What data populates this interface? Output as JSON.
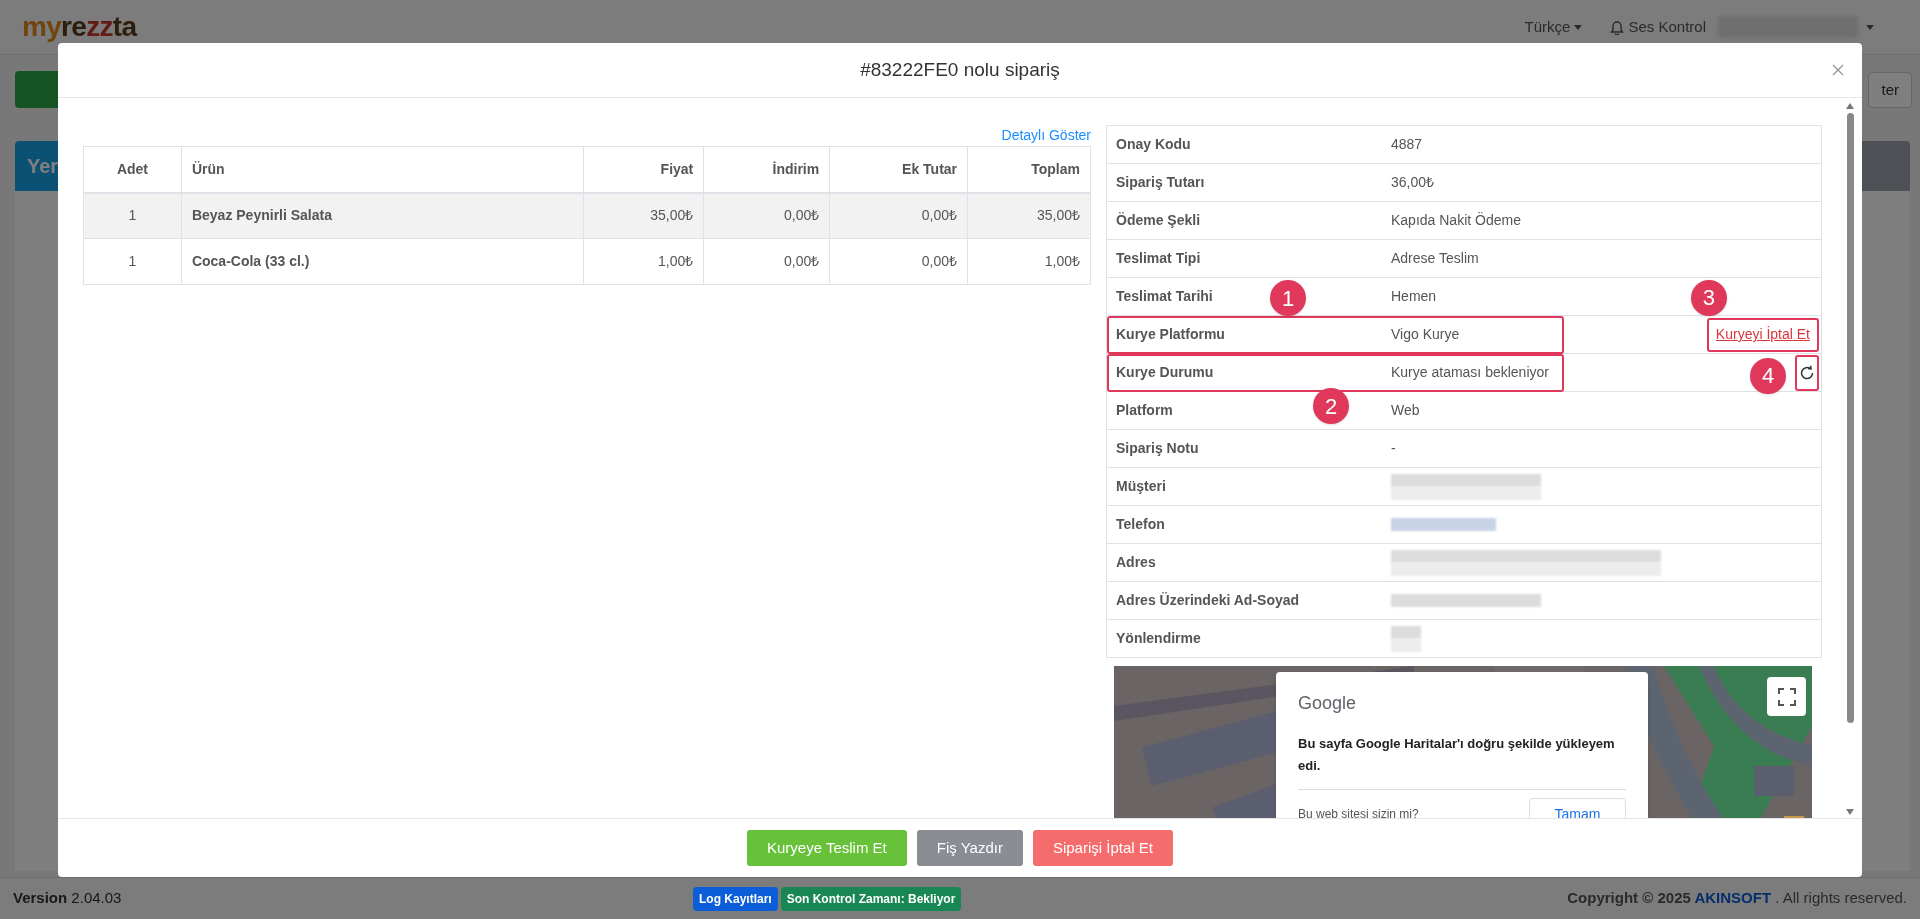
{
  "navbar": {
    "logo": [
      "my",
      "re",
      "zz",
      "ta"
    ],
    "language": "Türkçe",
    "sound": "Ses Kontrol"
  },
  "background": {
    "left_card_title": "Yer",
    "right_button": "ter"
  },
  "modal": {
    "title": "#83222FE0 nolu sipariş",
    "detail_link": "Detaylı Göster",
    "items_table": {
      "columns": [
        "Adet",
        "Ürün",
        "Fiyat",
        "İndirim",
        "Ek Tutar",
        "Toplam"
      ],
      "rows": [
        {
          "cells": [
            "1",
            "Beyaz Peynirli Salata",
            "35,00₺",
            "0,00₺",
            "0,00₺",
            "35,00₺"
          ],
          "hovered": true
        },
        {
          "cells": [
            "1",
            "Coca-Cola (33 cl.)",
            "1,00₺",
            "0,00₺",
            "0,00₺",
            "1,00₺"
          ],
          "hovered": false
        }
      ]
    },
    "info_rows": [
      {
        "label": "Onay Kodu",
        "value": "4887",
        "highlighted": false
      },
      {
        "label": "Sipariş Tutarı",
        "value": "36,00₺",
        "highlighted": false
      },
      {
        "label": "Ödeme Şekli",
        "value": "Kapıda Nakit Ödeme",
        "highlighted": false
      },
      {
        "label": "Teslimat Tipi",
        "value": "Adrese Teslim",
        "highlighted": false
      },
      {
        "label": "Teslimat Tarihi",
        "value": "Hemen",
        "highlighted": false
      },
      {
        "label": "Kurye Platformu",
        "value": "Vigo Kurye",
        "highlighted": true,
        "badge": "1",
        "action": {
          "kind": "link",
          "label": "Kuryeyi İptal Et",
          "highlighted": true,
          "badge": "3"
        }
      },
      {
        "label": "Kurye Durumu",
        "value": "Kurye ataması bekleniyor",
        "highlighted": true,
        "badge": "2",
        "action": {
          "kind": "refresh",
          "highlighted": true,
          "badge": "4"
        }
      },
      {
        "label": "Platform",
        "value": "Web",
        "highlighted": false
      },
      {
        "label": "Sipariş Notu",
        "value": "-",
        "highlighted": false
      },
      {
        "label": "Müşteri",
        "redacted": true,
        "highlighted": false
      },
      {
        "label": "Telefon",
        "redacted": true,
        "highlighted": false
      },
      {
        "label": "Adres",
        "redacted": true,
        "highlighted": false
      },
      {
        "label": "Adres Üzerindeki Ad-Soyad",
        "redacted": true,
        "highlighted": false
      },
      {
        "label": "Yönlendirme",
        "redacted": true,
        "highlighted": false
      }
    ],
    "map": {
      "kind": "picture",
      "dialog": {
        "brand": "Google",
        "message": "Bu sayfa Google Haritalar'ı doğru şekilde yükleyem edi.",
        "question": "Bu web sitesi sizin mi?",
        "button": "Tamam"
      }
    },
    "footer_buttons": [
      {
        "label": "Kuryeye Teslim Et",
        "kind": "success"
      },
      {
        "label": "Fiş Yazdır",
        "kind": "secondary"
      },
      {
        "label": "Siparişi İptal Et",
        "kind": "danger"
      }
    ]
  },
  "footer": {
    "version_label": "Version",
    "version": "2.04.03",
    "badges": [
      {
        "label": "Log Kayıtları",
        "color": "#0b5ed7"
      },
      {
        "label": "Son Kontrol Zamanı: Bekliyor",
        "color": "#198754"
      }
    ],
    "copyright": "Copyright © 2025",
    "company": "AKINSOFT",
    "rights": ". All rights reserved."
  }
}
